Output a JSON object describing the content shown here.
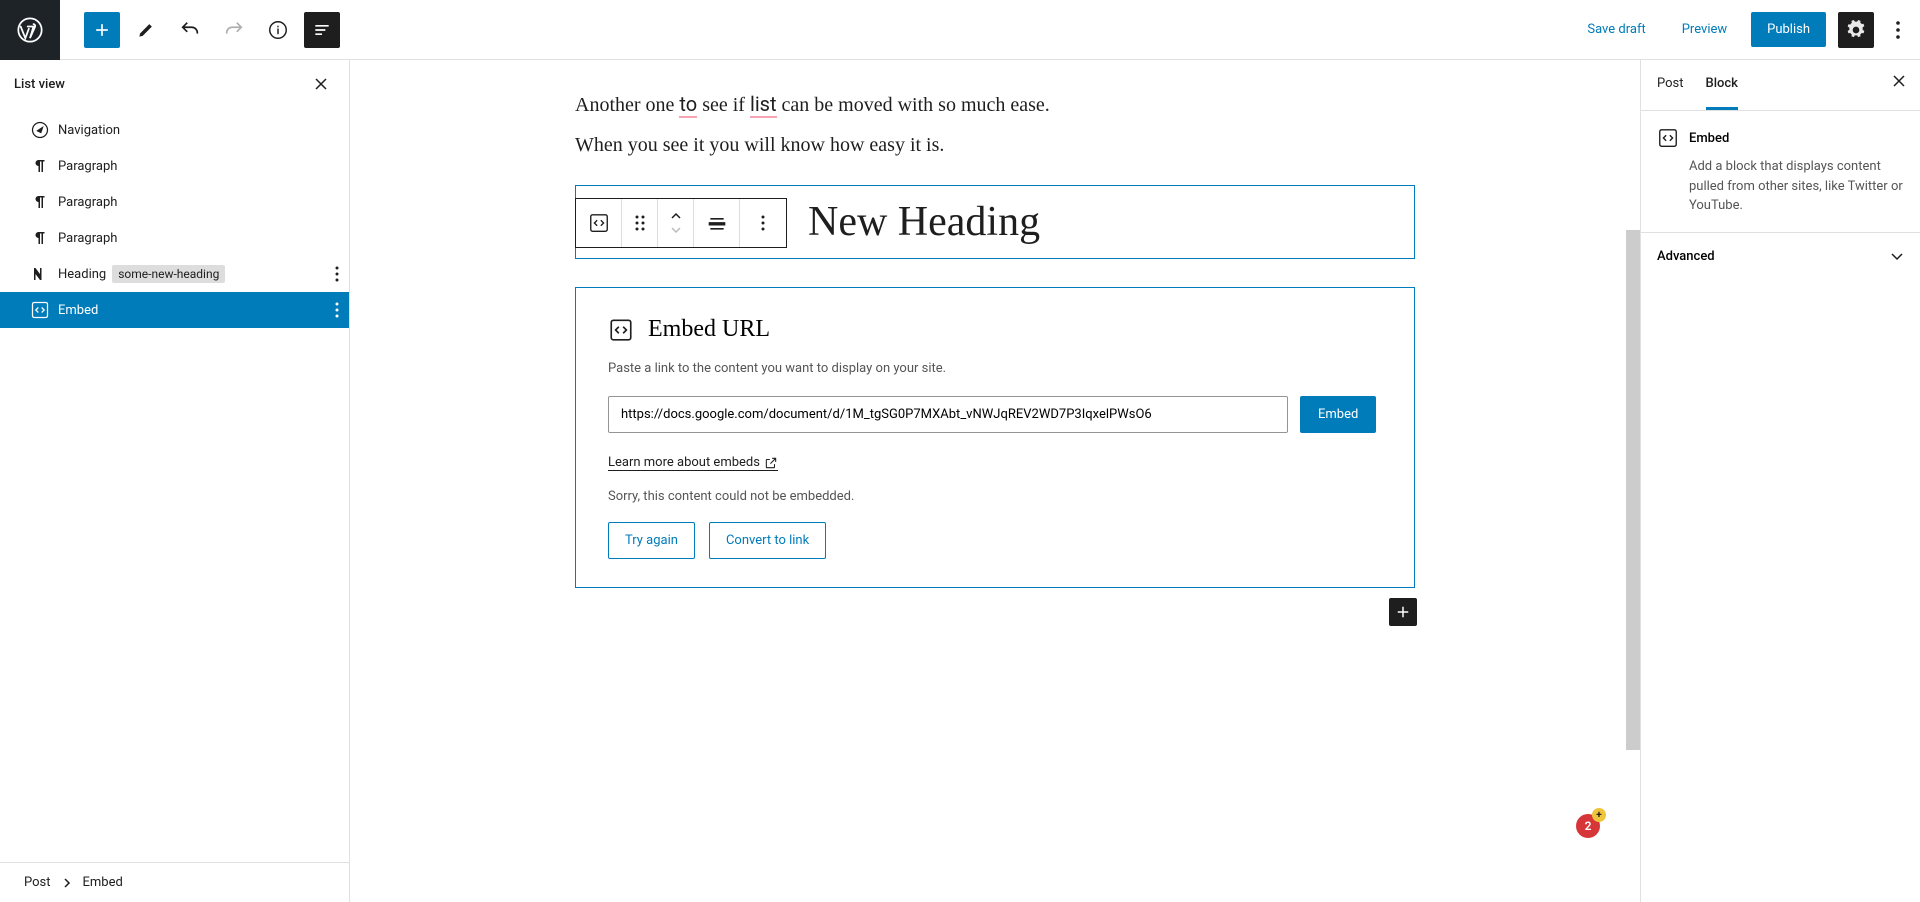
{
  "topbar": {
    "save_draft": "Save draft",
    "preview": "Preview",
    "publish": "Publish"
  },
  "list_view": {
    "title": "List view",
    "items": [
      {
        "label": "Navigation",
        "icon": "navigation"
      },
      {
        "label": "Paragraph",
        "icon": "paragraph"
      },
      {
        "label": "Paragraph",
        "icon": "paragraph"
      },
      {
        "label": "Paragraph",
        "icon": "paragraph"
      },
      {
        "label": "Heading",
        "icon": "heading",
        "badge": "some-new-heading",
        "has_more": true
      },
      {
        "label": "Embed",
        "icon": "embed",
        "selected": true,
        "has_more": true
      }
    ]
  },
  "breadcrumb": {
    "root": "Post",
    "current": "Embed"
  },
  "canvas": {
    "para1": "Another one to see if list can be moved with so much ease.",
    "para2": "When you see it you will know how easy it is.",
    "heading_text": "New Heading",
    "embed": {
      "title": "Embed URL",
      "desc": "Paste a link to the content you want to display on your site.",
      "input_value": "https://docs.google.com/document/d/1M_tgSG0P7MXAbt_vNWJqREV2WD7P3IqxelPWsO6",
      "button": "Embed",
      "learn_more": "Learn more about embeds",
      "error": "Sorry, this content could not be embedded.",
      "try_again": "Try again",
      "convert": "Convert to link"
    }
  },
  "right": {
    "tabs": {
      "post": "Post",
      "block": "Block"
    },
    "block_name": "Embed",
    "block_desc": "Add a block that displays content pulled from other sites, like Twitter or YouTube.",
    "advanced": "Advanced"
  },
  "notif_count": "2"
}
